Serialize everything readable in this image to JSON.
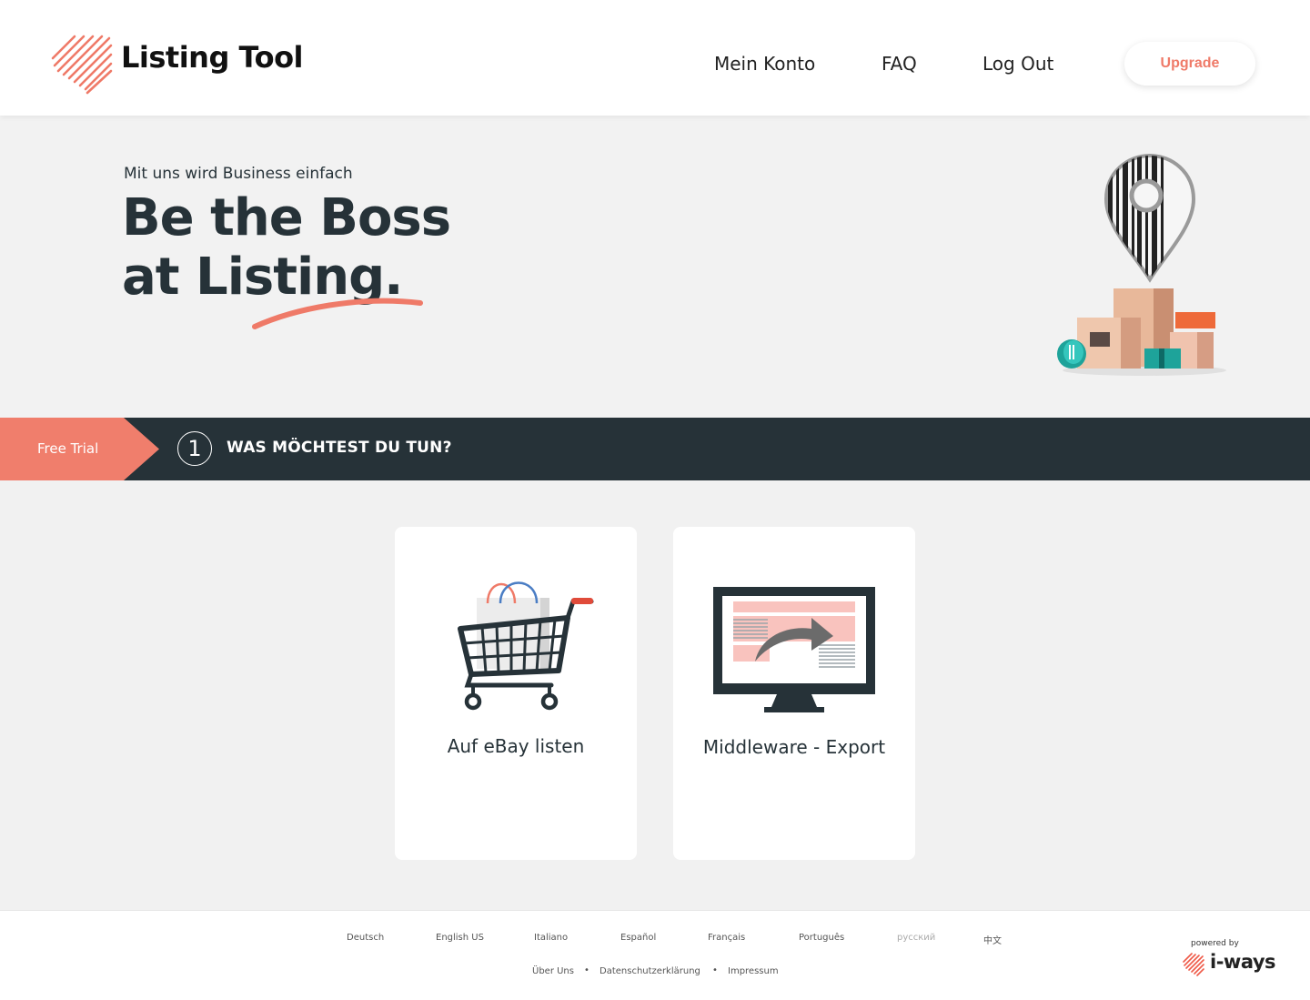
{
  "header": {
    "brand": "Listing Tool",
    "nav": {
      "account": "Mein Konto",
      "faq": "FAQ",
      "logout": "Log Out"
    },
    "upgrade": "Upgrade"
  },
  "hero": {
    "subtitle": "Mit uns wird Business einfach",
    "title_line1": "Be the Boss",
    "title_line2": "at Listing."
  },
  "step": {
    "badge": "Free Trial",
    "number": "1",
    "title": "WAS MÖCHTEST DU TUN?"
  },
  "cards": [
    {
      "label": "Auf eBay listen",
      "icon": "shopping-cart-icon"
    },
    {
      "label": "Middleware - Export",
      "icon": "monitor-export-icon"
    }
  ],
  "footer": {
    "languages": [
      "Deutsch",
      "English US",
      "Italiano",
      "Español",
      "Français",
      "Português",
      "русский",
      "中文"
    ],
    "links": [
      "Über Uns",
      "Datenschutzerklärung",
      "Impressum"
    ],
    "separator": "•",
    "powered_by": "powered by",
    "partner": "i-ways"
  },
  "colors": {
    "accent": "#ef7a68",
    "dark": "#263238",
    "background": "#f2f2f2"
  }
}
